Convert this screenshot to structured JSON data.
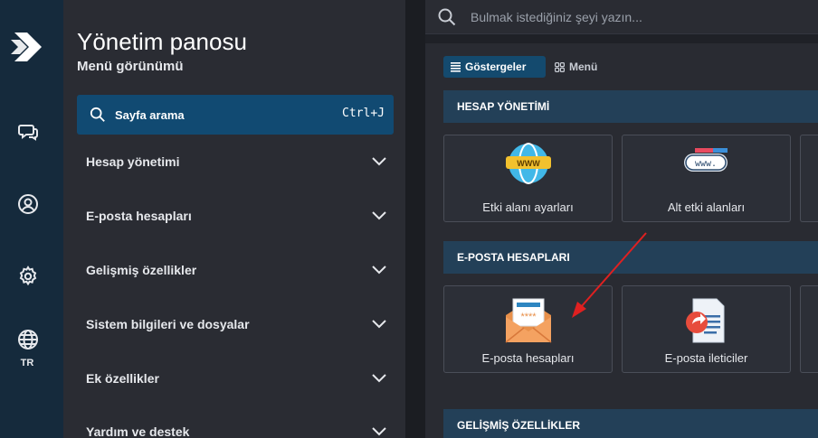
{
  "rail": {
    "items": [
      {
        "name": "chat-icon"
      },
      {
        "name": "user-icon"
      },
      {
        "name": "gear-icon"
      },
      {
        "name": "globe-icon",
        "label": "TR"
      }
    ]
  },
  "menu": {
    "title": "Yönetim panosu",
    "subtitle": "Menü görünümü",
    "search": {
      "label": "Sayfa arama",
      "shortcut": "Ctrl+J"
    },
    "items": [
      {
        "label": "Hesap yönetimi"
      },
      {
        "label": "E-posta hesapları"
      },
      {
        "label": "Gelişmiş özellikler"
      },
      {
        "label": "Sistem bilgileri ve dosyalar"
      },
      {
        "label": "Ek özellikler"
      },
      {
        "label": "Yardım ve destek"
      }
    ]
  },
  "main": {
    "search_placeholder": "Bulmak istediğiniz şeyi yazın...",
    "tabs": [
      {
        "label": "Göstergeler",
        "active": true
      },
      {
        "label": "Menü",
        "active": false
      }
    ],
    "sections": [
      {
        "title": "HESAP YÖNETİMİ",
        "cards": [
          {
            "label": "Etki alanı ayarları",
            "icon": "www-globe-icon"
          },
          {
            "label": "Alt etki alanları",
            "icon": "www-bar-icon"
          }
        ]
      },
      {
        "title": "E-POSTA HESAPLARI",
        "cards": [
          {
            "label": "E-posta hesapları",
            "icon": "envelope-icon"
          },
          {
            "label": "E-posta ileticiler",
            "icon": "forward-document-icon"
          }
        ]
      },
      {
        "title": "GELİŞMİŞ ÖZELLİKLER",
        "cards": []
      }
    ]
  },
  "colors": {
    "rail_bg": "#152a3c",
    "menu_bg": "#2a2c33",
    "accent": "#114a72",
    "section_bg": "#234058",
    "annotation_arrow": "#e02020"
  }
}
